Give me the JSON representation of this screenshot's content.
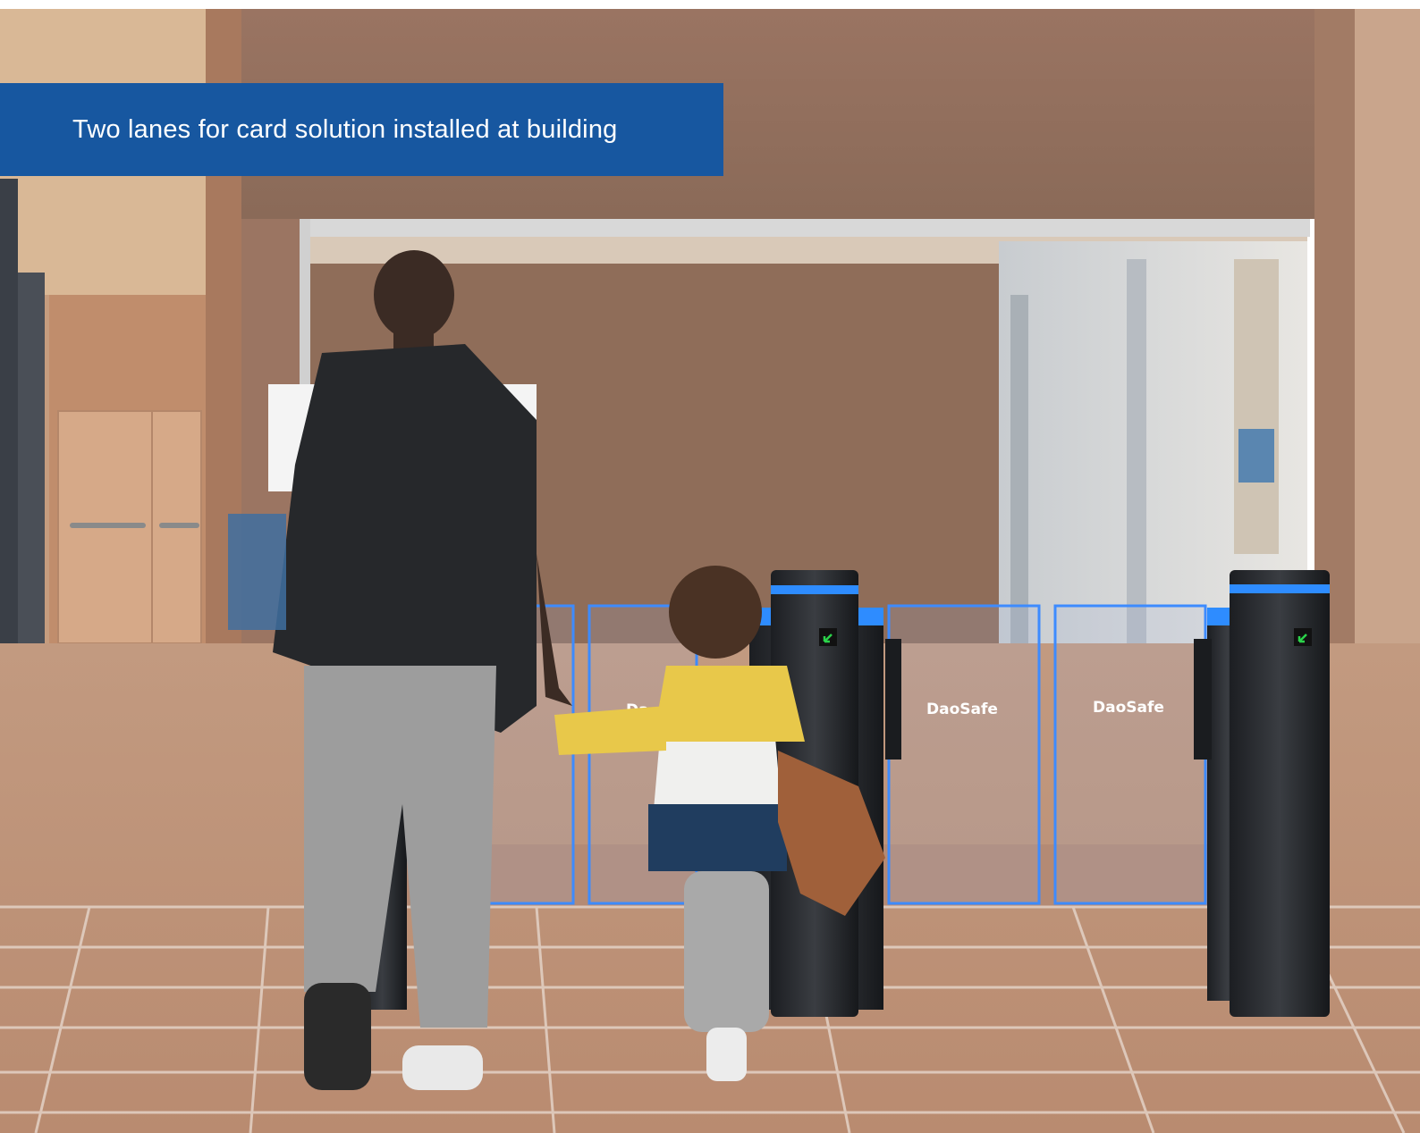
{
  "caption": {
    "text": "Two lanes for card solution installed at building"
  },
  "gate_branding": {
    "label_1": "DaoSafe",
    "label_2": "DaoSafe",
    "label_partial": "Da"
  },
  "colors": {
    "banner": "#1757a0",
    "led_light": "#2e8cff",
    "wall": "#8f6d5a",
    "floor_tile": "#c9a48e"
  },
  "icons": {
    "gate_indicator": "green-entry-arrow-icon"
  }
}
